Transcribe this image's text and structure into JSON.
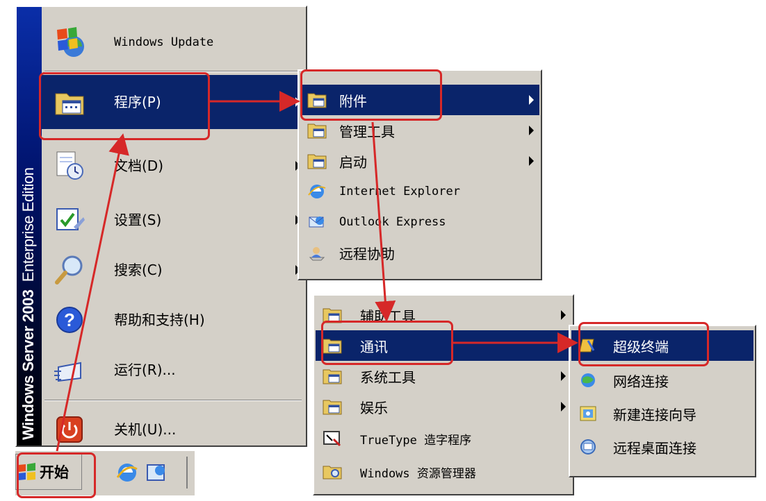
{
  "start_menu": {
    "brand": {
      "product": "Windows Server",
      "version": "2003",
      "edition": "Enterprise Edition"
    },
    "items": [
      {
        "label": "Windows Update",
        "icon": "windows-update-icon"
      },
      {
        "label": "程序(P)",
        "icon": "programs-folder-icon",
        "selected": true
      },
      {
        "label": "文档(D)",
        "icon": "documents-icon"
      },
      {
        "label": "设置(S)",
        "icon": "settings-icon"
      },
      {
        "label": "搜索(C)",
        "icon": "search-icon"
      },
      {
        "label": "帮助和支持(H)",
        "icon": "help-icon"
      },
      {
        "label": "运行(R)...",
        "icon": "run-icon"
      },
      {
        "label": "关机(U)...",
        "icon": "shutdown-icon"
      }
    ]
  },
  "programs_menu": {
    "items": [
      {
        "label": "附件",
        "selected": true
      },
      {
        "label": "管理工具"
      },
      {
        "label": "启动"
      },
      {
        "label": "Internet Explorer"
      },
      {
        "label": "Outlook Express"
      },
      {
        "label": "远程协助"
      }
    ]
  },
  "accessories_menu": {
    "items": [
      {
        "label": "辅助工具"
      },
      {
        "label": "通讯",
        "selected": true
      },
      {
        "label": "系统工具"
      },
      {
        "label": "娱乐"
      },
      {
        "label": "TrueType 造字程序"
      },
      {
        "label": "Windows 资源管理器"
      }
    ]
  },
  "communications_menu": {
    "items": [
      {
        "label": "超级终端",
        "selected": true
      },
      {
        "label": "网络连接"
      },
      {
        "label": "新建连接向导"
      },
      {
        "label": "远程桌面连接"
      }
    ]
  },
  "taskbar": {
    "start_label": "开始"
  },
  "colors": {
    "highlight": "#0a246a",
    "menu_bg": "#d4d0c8",
    "annotation": "#d62828"
  }
}
